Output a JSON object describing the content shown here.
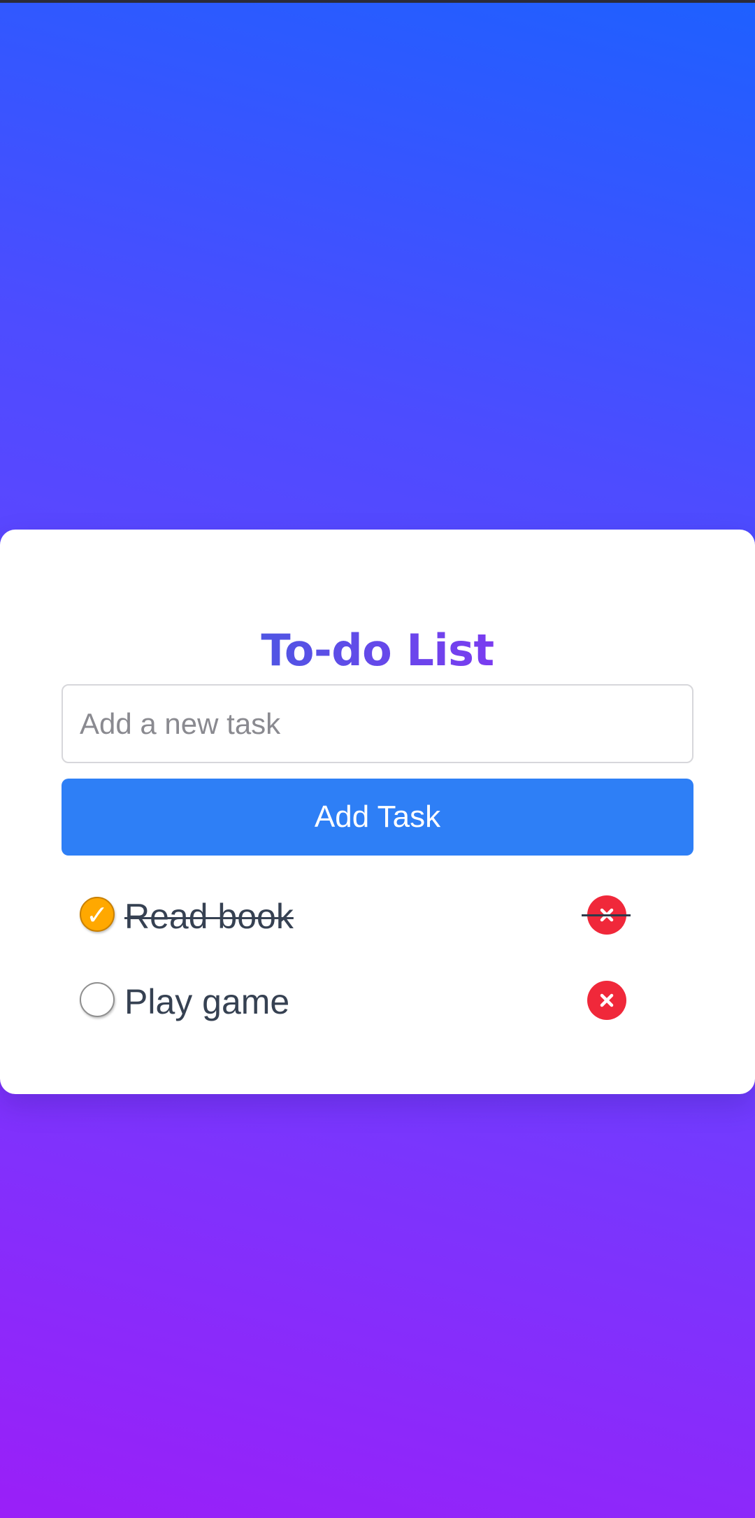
{
  "app": {
    "title": "To-do List"
  },
  "new_task": {
    "placeholder": "Add a new task",
    "value": ""
  },
  "add_button": {
    "label": "Add Task"
  },
  "tasks": [
    {
      "label": "Read book",
      "completed": true
    },
    {
      "label": "Play game",
      "completed": false
    }
  ],
  "icons": {
    "check": "checkmark-icon",
    "delete": "close-icon"
  },
  "colors": {
    "title": "#5a48e0",
    "add_button": "#2e7ff6",
    "checked": "#ffa800",
    "delete": "#f0283a",
    "text": "#364152"
  }
}
